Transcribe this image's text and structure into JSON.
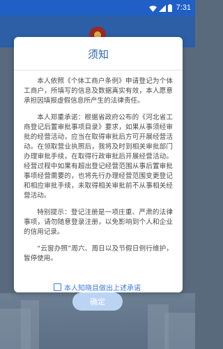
{
  "status_bar": {
    "time": "7:31",
    "icons": [
      "wifi-icon",
      "signal-icon",
      "battery-icon"
    ]
  },
  "colors": {
    "status_bar": "#1f5fc6",
    "title": "#2c64b5",
    "accent": "#3d7be0",
    "button_disabled": "#bcd4f3"
  },
  "dialog": {
    "title": "须知",
    "paragraphs": [
      "本人依照《个体工商户条例》申请登记为个体工商户，所填写的信息及数据真实有效，本人愿意承担因填报虚假信息所产生的法律责任。",
      "本人郑重承诺：根据省政府公布的《河北省工商登记后置审批事项目录》要求，如果从事须经审批的经营活动，应当在取得审批后方可开展经营活动。在领取营业执照后，我将及时到相关审批部门办理审批手续，在取得行政审批后开展经营活动。经营过程中如果有超出登记经营范围从事后置审批事项经营需要的，也将先行办理经营范围变更登记和相应审批手续，未取得相关审批前不从事相关经营活动。",
      "特别提示：登记注册是一项庄重、严肃的法律事项，请勿随意登录注册，以免影响到个人和企业的信用记录。",
      "“云窗办照”周六、周日以及节假日例行维护，暂停使用。"
    ],
    "agree_label": "本人知晓且做出上述承诺",
    "agree_checked": false,
    "confirm_label": "确定"
  }
}
